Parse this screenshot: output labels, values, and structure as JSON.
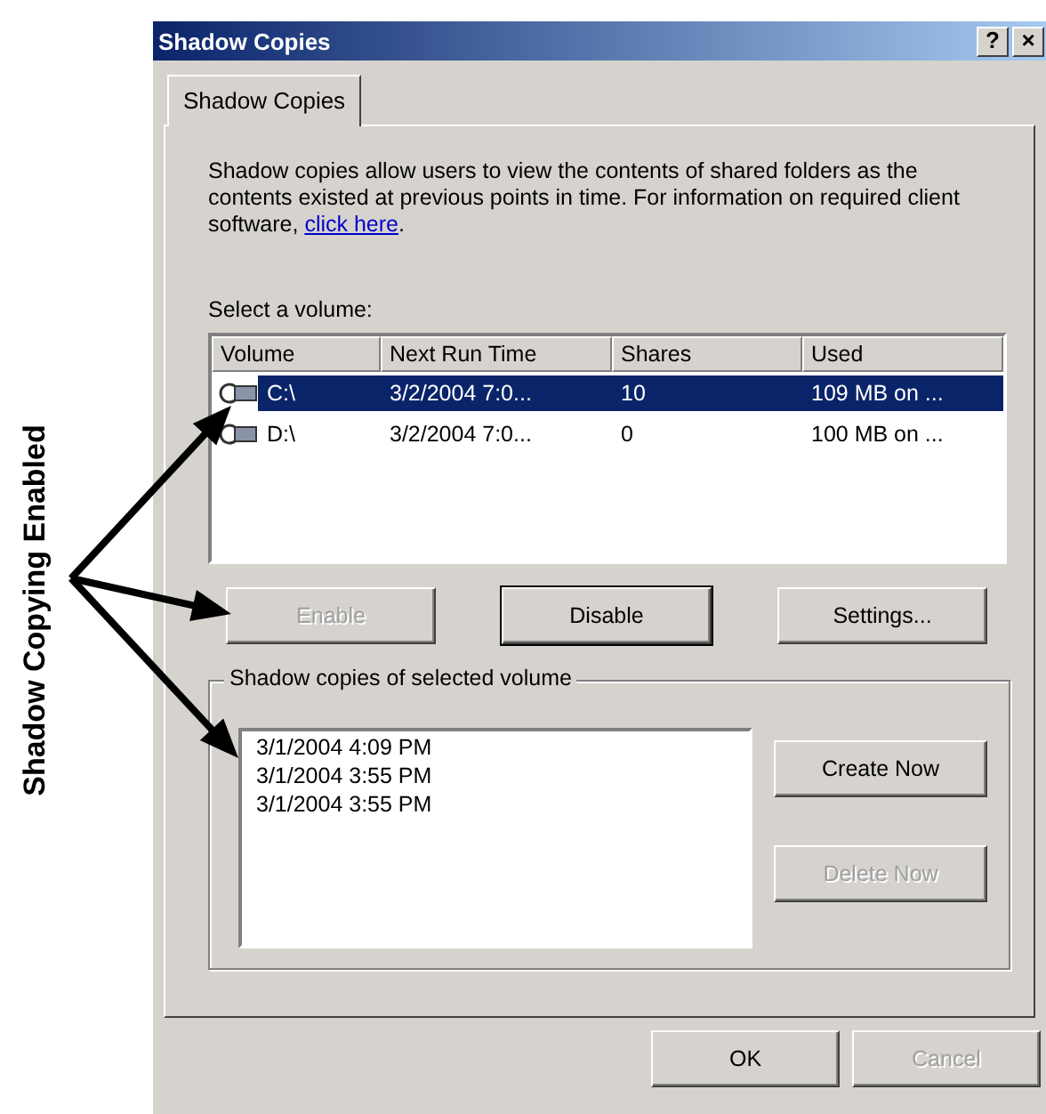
{
  "annotation": {
    "label": "Shadow Copying Enabled"
  },
  "window": {
    "title": "Shadow Copies",
    "title_buttons": [
      "?",
      "×"
    ]
  },
  "tabs": [
    {
      "label": "Shadow Copies",
      "selected": true
    }
  ],
  "description": {
    "text": "Shadow copies allow users to view the contents of shared folders as the contents existed at previous points in time. For information on required client software, ",
    "link": "click here",
    "end": "."
  },
  "volume_list": {
    "label": "Select a volume:",
    "columns": [
      "Volume",
      "Next Run Time",
      "Shares",
      "Used"
    ],
    "rows": [
      {
        "cells": [
          "C:\\",
          "3/2/2004 7:0...",
          "10",
          "109 MB on ..."
        ],
        "selected": true
      },
      {
        "cells": [
          "D:\\",
          "3/2/2004 7:0...",
          "0",
          "100 MB on ..."
        ],
        "selected": false
      }
    ]
  },
  "volume_buttons": [
    {
      "label": "Enable",
      "disabled": true,
      "focused": false
    },
    {
      "label": "Disable",
      "disabled": false,
      "focused": true
    },
    {
      "label": "Settings...",
      "disabled": false,
      "focused": false
    }
  ],
  "snapshots": {
    "title": "Shadow copies of selected volume",
    "items": [
      "3/1/2004 4:09 PM",
      "3/1/2004 3:55 PM",
      "3/1/2004 3:55 PM"
    ],
    "buttons": [
      {
        "label": "Create Now",
        "disabled": false
      },
      {
        "label": "Delete Now",
        "disabled": true
      }
    ]
  },
  "footer_buttons": [
    {
      "label": "OK",
      "disabled": false
    },
    {
      "label": "Cancel",
      "disabled": true
    }
  ]
}
